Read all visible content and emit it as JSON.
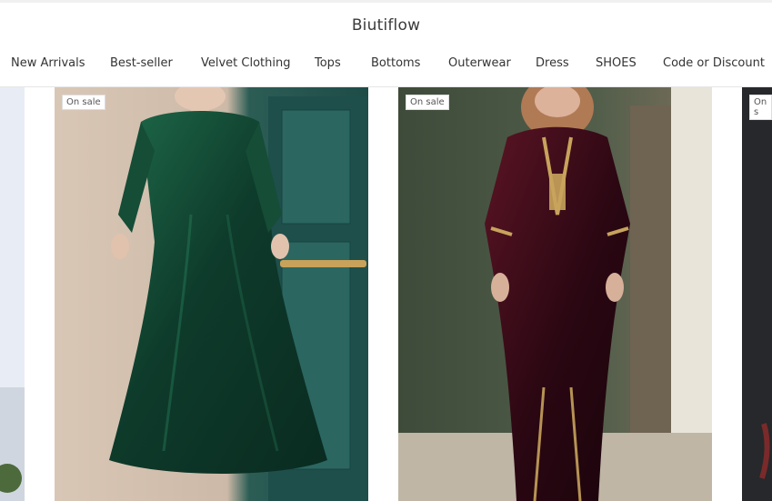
{
  "header": {
    "brand": "Biutiflow"
  },
  "nav": {
    "items": [
      {
        "label": "New Arrivals"
      },
      {
        "label": "Best-seller"
      },
      {
        "label": "Velvet Clothing"
      },
      {
        "label": "Tops"
      },
      {
        "label": "Bottoms"
      },
      {
        "label": "Outerwear"
      },
      {
        "label": "Dress"
      },
      {
        "label": "SHOES"
      },
      {
        "label": "Code or Discount"
      }
    ]
  },
  "products": [
    {
      "badge": "",
      "color": "#dfe3ea"
    },
    {
      "badge": "On sale",
      "color": "#0f3d2a"
    },
    {
      "badge": "On sale",
      "color": "#3b0f1d"
    },
    {
      "badge": "On s",
      "color": "#2b2b2b"
    }
  ]
}
